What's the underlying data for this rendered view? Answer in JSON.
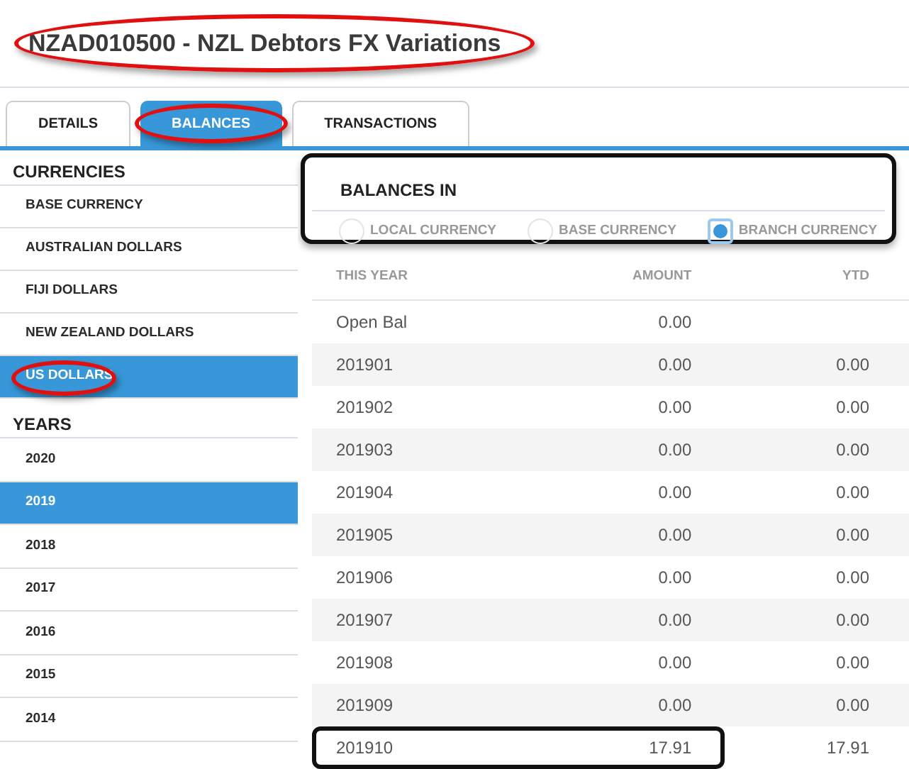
{
  "title": {
    "text": "NZAD010500 - NZL Debtors FX Variations",
    "circled": true
  },
  "tabs": [
    {
      "label": "DETAILS",
      "selected": false,
      "circled": false
    },
    {
      "label": "BALANCES",
      "selected": true,
      "circled": true
    },
    {
      "label": "TRANSACTIONS",
      "selected": false,
      "circled": false
    }
  ],
  "sidebar": {
    "currencies_heading": "CURRENCIES",
    "currencies": [
      {
        "label": "BASE CURRENCY",
        "selected": false,
        "circled": false
      },
      {
        "label": "AUSTRALIAN DOLLARS",
        "selected": false,
        "circled": false
      },
      {
        "label": "FIJI DOLLARS",
        "selected": false,
        "circled": false
      },
      {
        "label": "NEW ZEALAND DOLLARS",
        "selected": false,
        "circled": false
      },
      {
        "label": "US DOLLARS",
        "selected": true,
        "circled": true
      }
    ],
    "years_heading": "YEARS",
    "years": [
      {
        "label": "2020",
        "selected": false
      },
      {
        "label": "2019",
        "selected": true
      },
      {
        "label": "2018",
        "selected": false
      },
      {
        "label": "2017",
        "selected": false
      },
      {
        "label": "2016",
        "selected": false
      },
      {
        "label": "2015",
        "selected": false
      },
      {
        "label": "2014",
        "selected": false
      }
    ]
  },
  "balances_in": {
    "heading": "BALANCES IN",
    "framed": true,
    "options": [
      {
        "label": "LOCAL CURRENCY",
        "selected": false
      },
      {
        "label": "BASE CURRENCY",
        "selected": false
      },
      {
        "label": "BRANCH CURRENCY",
        "selected": true
      }
    ]
  },
  "table": {
    "columns": [
      "THIS YEAR",
      "AMOUNT",
      "YTD"
    ],
    "rows": [
      {
        "cells": [
          "Open Bal",
          "0.00",
          ""
        ],
        "framed": false
      },
      {
        "cells": [
          "201901",
          "0.00",
          "0.00"
        ],
        "framed": false
      },
      {
        "cells": [
          "201902",
          "0.00",
          "0.00"
        ],
        "framed": false
      },
      {
        "cells": [
          "201903",
          "0.00",
          "0.00"
        ],
        "framed": false
      },
      {
        "cells": [
          "201904",
          "0.00",
          "0.00"
        ],
        "framed": false
      },
      {
        "cells": [
          "201905",
          "0.00",
          "0.00"
        ],
        "framed": false
      },
      {
        "cells": [
          "201906",
          "0.00",
          "0.00"
        ],
        "framed": false
      },
      {
        "cells": [
          "201907",
          "0.00",
          "0.00"
        ],
        "framed": false
      },
      {
        "cells": [
          "201908",
          "0.00",
          "0.00"
        ],
        "framed": false
      },
      {
        "cells": [
          "201909",
          "0.00",
          "0.00"
        ],
        "framed": false
      },
      {
        "cells": [
          "201910",
          "17.91",
          "17.91"
        ],
        "framed": true
      }
    ]
  }
}
